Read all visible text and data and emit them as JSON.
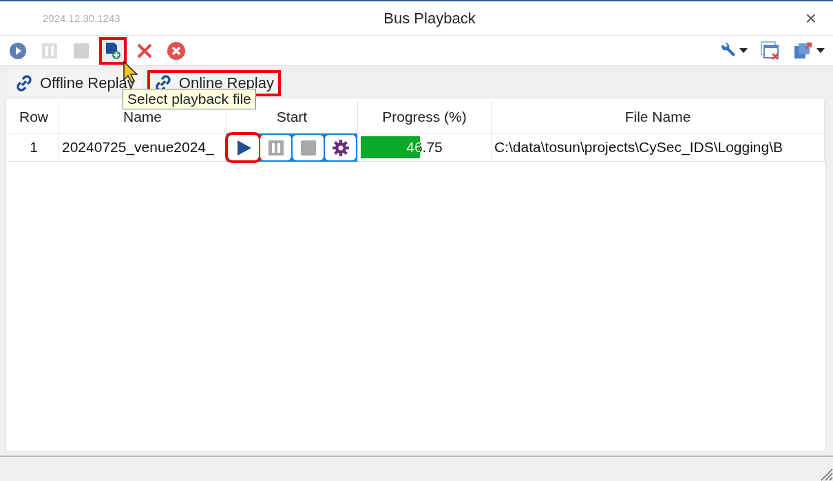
{
  "window": {
    "version": "2024.12.30.1243",
    "title": "Bus Playback",
    "close": "×"
  },
  "toolbar": {
    "left": [
      {
        "kind": "play",
        "disabled": false,
        "highlighted": false
      },
      {
        "kind": "pause",
        "disabled": true,
        "highlighted": false
      },
      {
        "kind": "stop",
        "disabled": true,
        "highlighted": false
      },
      {
        "kind": "add-file",
        "disabled": false,
        "highlighted": true
      },
      {
        "kind": "delete",
        "disabled": false,
        "highlighted": false
      },
      {
        "kind": "delete-all",
        "disabled": false,
        "highlighted": false
      }
    ],
    "right": [
      {
        "kind": "wrench",
        "dropdown": true
      },
      {
        "kind": "close-windows",
        "dropdown": false
      },
      {
        "kind": "export",
        "dropdown": true
      }
    ]
  },
  "tabs": [
    {
      "label": "Offline Replay",
      "highlighted": false
    },
    {
      "label": "Online Replay",
      "highlighted": true
    }
  ],
  "tooltip": "Select playback file",
  "table": {
    "columns": [
      "Row",
      "Name",
      "Start",
      "Progress (%)",
      "File Name"
    ],
    "rows": [
      {
        "row": "1",
        "name": "20240725_venue2024_",
        "controls": [
          {
            "kind": "play",
            "highlighted": true
          },
          {
            "kind": "pause",
            "highlighted": false
          },
          {
            "kind": "stop",
            "highlighted": false
          },
          {
            "kind": "settings",
            "highlighted": false
          }
        ],
        "progress": {
          "level": 0.4675,
          "reading": "46.75"
        },
        "file_name": "C:\\data\\tosun\\projects\\CySec_IDS\\Logging\\B"
      }
    ]
  }
}
